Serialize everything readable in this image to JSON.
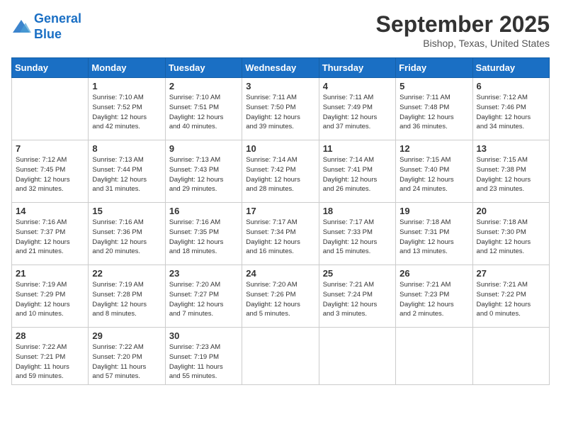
{
  "logo": {
    "line1": "General",
    "line2": "Blue"
  },
  "title": "September 2025",
  "location": "Bishop, Texas, United States",
  "days_of_week": [
    "Sunday",
    "Monday",
    "Tuesday",
    "Wednesday",
    "Thursday",
    "Friday",
    "Saturday"
  ],
  "weeks": [
    [
      {
        "num": "",
        "info": ""
      },
      {
        "num": "1",
        "info": "Sunrise: 7:10 AM\nSunset: 7:52 PM\nDaylight: 12 hours\nand 42 minutes."
      },
      {
        "num": "2",
        "info": "Sunrise: 7:10 AM\nSunset: 7:51 PM\nDaylight: 12 hours\nand 40 minutes."
      },
      {
        "num": "3",
        "info": "Sunrise: 7:11 AM\nSunset: 7:50 PM\nDaylight: 12 hours\nand 39 minutes."
      },
      {
        "num": "4",
        "info": "Sunrise: 7:11 AM\nSunset: 7:49 PM\nDaylight: 12 hours\nand 37 minutes."
      },
      {
        "num": "5",
        "info": "Sunrise: 7:11 AM\nSunset: 7:48 PM\nDaylight: 12 hours\nand 36 minutes."
      },
      {
        "num": "6",
        "info": "Sunrise: 7:12 AM\nSunset: 7:46 PM\nDaylight: 12 hours\nand 34 minutes."
      }
    ],
    [
      {
        "num": "7",
        "info": "Sunrise: 7:12 AM\nSunset: 7:45 PM\nDaylight: 12 hours\nand 32 minutes."
      },
      {
        "num": "8",
        "info": "Sunrise: 7:13 AM\nSunset: 7:44 PM\nDaylight: 12 hours\nand 31 minutes."
      },
      {
        "num": "9",
        "info": "Sunrise: 7:13 AM\nSunset: 7:43 PM\nDaylight: 12 hours\nand 29 minutes."
      },
      {
        "num": "10",
        "info": "Sunrise: 7:14 AM\nSunset: 7:42 PM\nDaylight: 12 hours\nand 28 minutes."
      },
      {
        "num": "11",
        "info": "Sunrise: 7:14 AM\nSunset: 7:41 PM\nDaylight: 12 hours\nand 26 minutes."
      },
      {
        "num": "12",
        "info": "Sunrise: 7:15 AM\nSunset: 7:40 PM\nDaylight: 12 hours\nand 24 minutes."
      },
      {
        "num": "13",
        "info": "Sunrise: 7:15 AM\nSunset: 7:38 PM\nDaylight: 12 hours\nand 23 minutes."
      }
    ],
    [
      {
        "num": "14",
        "info": "Sunrise: 7:16 AM\nSunset: 7:37 PM\nDaylight: 12 hours\nand 21 minutes."
      },
      {
        "num": "15",
        "info": "Sunrise: 7:16 AM\nSunset: 7:36 PM\nDaylight: 12 hours\nand 20 minutes."
      },
      {
        "num": "16",
        "info": "Sunrise: 7:16 AM\nSunset: 7:35 PM\nDaylight: 12 hours\nand 18 minutes."
      },
      {
        "num": "17",
        "info": "Sunrise: 7:17 AM\nSunset: 7:34 PM\nDaylight: 12 hours\nand 16 minutes."
      },
      {
        "num": "18",
        "info": "Sunrise: 7:17 AM\nSunset: 7:33 PM\nDaylight: 12 hours\nand 15 minutes."
      },
      {
        "num": "19",
        "info": "Sunrise: 7:18 AM\nSunset: 7:31 PM\nDaylight: 12 hours\nand 13 minutes."
      },
      {
        "num": "20",
        "info": "Sunrise: 7:18 AM\nSunset: 7:30 PM\nDaylight: 12 hours\nand 12 minutes."
      }
    ],
    [
      {
        "num": "21",
        "info": "Sunrise: 7:19 AM\nSunset: 7:29 PM\nDaylight: 12 hours\nand 10 minutes."
      },
      {
        "num": "22",
        "info": "Sunrise: 7:19 AM\nSunset: 7:28 PM\nDaylight: 12 hours\nand 8 minutes."
      },
      {
        "num": "23",
        "info": "Sunrise: 7:20 AM\nSunset: 7:27 PM\nDaylight: 12 hours\nand 7 minutes."
      },
      {
        "num": "24",
        "info": "Sunrise: 7:20 AM\nSunset: 7:26 PM\nDaylight: 12 hours\nand 5 minutes."
      },
      {
        "num": "25",
        "info": "Sunrise: 7:21 AM\nSunset: 7:24 PM\nDaylight: 12 hours\nand 3 minutes."
      },
      {
        "num": "26",
        "info": "Sunrise: 7:21 AM\nSunset: 7:23 PM\nDaylight: 12 hours\nand 2 minutes."
      },
      {
        "num": "27",
        "info": "Sunrise: 7:21 AM\nSunset: 7:22 PM\nDaylight: 12 hours\nand 0 minutes."
      }
    ],
    [
      {
        "num": "28",
        "info": "Sunrise: 7:22 AM\nSunset: 7:21 PM\nDaylight: 11 hours\nand 59 minutes."
      },
      {
        "num": "29",
        "info": "Sunrise: 7:22 AM\nSunset: 7:20 PM\nDaylight: 11 hours\nand 57 minutes."
      },
      {
        "num": "30",
        "info": "Sunrise: 7:23 AM\nSunset: 7:19 PM\nDaylight: 11 hours\nand 55 minutes."
      },
      {
        "num": "",
        "info": ""
      },
      {
        "num": "",
        "info": ""
      },
      {
        "num": "",
        "info": ""
      },
      {
        "num": "",
        "info": ""
      }
    ]
  ]
}
